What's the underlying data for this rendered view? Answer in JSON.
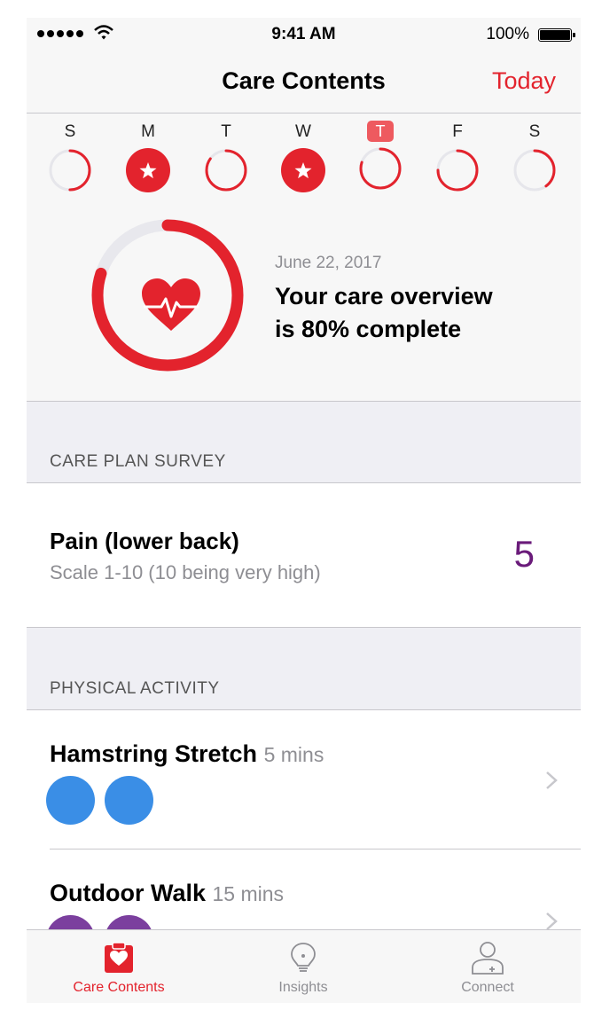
{
  "status_bar": {
    "time": "9:41 AM",
    "battery": "100%"
  },
  "nav": {
    "title": "Care Contents",
    "right_button": "Today"
  },
  "week": [
    {
      "letter": "S",
      "progress": 0.5,
      "completed": false,
      "today": false
    },
    {
      "letter": "M",
      "progress": 1.0,
      "completed": true,
      "today": false
    },
    {
      "letter": "T",
      "progress": 0.85,
      "completed": false,
      "today": false
    },
    {
      "letter": "W",
      "progress": 1.0,
      "completed": true,
      "today": false
    },
    {
      "letter": "T",
      "progress": 0.8,
      "completed": false,
      "today": true
    },
    {
      "letter": "F",
      "progress": 0.75,
      "completed": false,
      "today": false
    },
    {
      "letter": "S",
      "progress": 0.4,
      "completed": false,
      "today": false
    }
  ],
  "overview": {
    "date": "June 22, 2017",
    "line1": "Your care overview",
    "line2": "is 80% complete",
    "progress": 0.8
  },
  "survey_section": {
    "header": "CARE PLAN SURVEY",
    "item": {
      "title": "Pain (lower back)",
      "subtitle": "Scale 1-10 (10 being very high)",
      "value": "5"
    }
  },
  "activity_section": {
    "header": "PHYSICAL ACTIVITY",
    "items": [
      {
        "title": "Hamstring Stretch",
        "duration": "5 mins",
        "color": "#3a8ee6",
        "circles": 2
      },
      {
        "title": "Outdoor Walk",
        "duration": "15 mins",
        "color": "#7b3f9e",
        "circles": 2
      }
    ]
  },
  "tabs": [
    {
      "label": "Care Contents",
      "icon": "clipboard-heart-icon",
      "active": true
    },
    {
      "label": "Insights",
      "icon": "lightbulb-icon",
      "active": false
    },
    {
      "label": "Connect",
      "icon": "person-add-icon",
      "active": false
    }
  ],
  "colors": {
    "accent": "#e3232d",
    "survey_value": "#6a1b7a"
  }
}
